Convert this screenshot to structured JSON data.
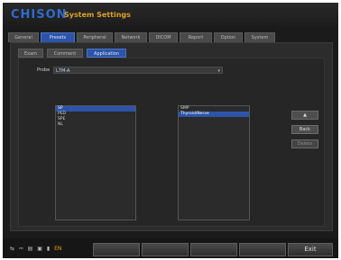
{
  "app": {
    "logo": "CHISON",
    "title": "System Settings"
  },
  "tabs": [
    {
      "label": "General",
      "active": false
    },
    {
      "label": "Presets",
      "active": true
    },
    {
      "label": "Peripheral",
      "active": false
    },
    {
      "label": "Network",
      "active": false
    },
    {
      "label": "DICOM",
      "active": false
    },
    {
      "label": "Report",
      "active": false
    },
    {
      "label": "Option",
      "active": false
    },
    {
      "label": "System",
      "active": false
    }
  ],
  "subtabs": [
    {
      "label": "Exam",
      "active": false
    },
    {
      "label": "Comment",
      "active": false
    },
    {
      "label": "Application",
      "active": true
    }
  ],
  "probe": {
    "label": "Probe",
    "value": "L7M-A"
  },
  "left_list": {
    "items": [
      "SP",
      "PED",
      "SPE",
      "NL"
    ],
    "selected_index": 0
  },
  "right_list": {
    "items": [
      "SMP",
      "Thyroid/Nerve"
    ],
    "selected_index": 1
  },
  "side_buttons": {
    "up": "▲",
    "down": "Back",
    "delete": "Delete"
  },
  "status": {
    "icons": [
      "network-icon",
      "usb-icon",
      "printer-icon",
      "disk-icon",
      "battery-icon"
    ],
    "locale": "EN"
  },
  "bottom_buttons": [
    "",
    "",
    "",
    "",
    "",
    "Exit"
  ]
}
